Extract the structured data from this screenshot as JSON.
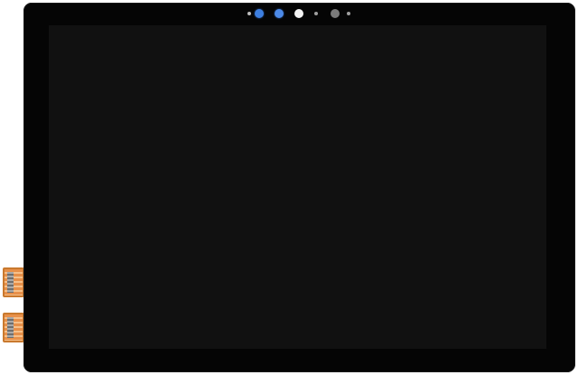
{
  "device": {
    "kind": "tablet-display-panel",
    "screen_state": "off",
    "colors": {
      "bezel": "#050505",
      "screen": "#111111",
      "flex_cable": "#e7904a",
      "camera_lens_blue": "#3d7fe0",
      "ir_emitter": "#f4f4f4"
    }
  },
  "front_sensors": [
    {
      "name": "proximity-sensor-left",
      "color": "#bdbdbd"
    },
    {
      "name": "ir-camera-lens-1",
      "color": "#3d7fe0"
    },
    {
      "name": "ir-camera-lens-2",
      "color": "#4c8ae8"
    },
    {
      "name": "ir-emitter",
      "color": "#f4f4f4"
    },
    {
      "name": "ambient-light-sensor",
      "color": "#9e9e9e"
    },
    {
      "name": "front-camera-lens",
      "color": "#7b7b7b"
    },
    {
      "name": "proximity-sensor-right",
      "color": "#9e9e9e"
    }
  ],
  "flex_connectors": [
    {
      "name": "flex-connector-top",
      "icon": "ribbon-cable-icon"
    },
    {
      "name": "flex-connector-bottom",
      "icon": "ribbon-cable-icon"
    }
  ]
}
